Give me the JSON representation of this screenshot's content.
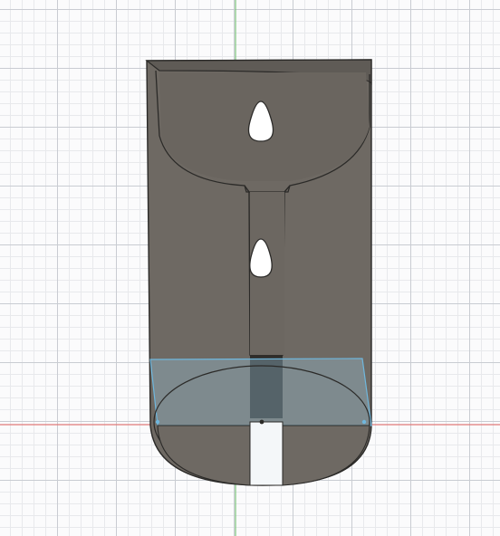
{
  "scene": {
    "background_color": "#fbfbfc",
    "grid_minor_color": "#e8e9ec",
    "grid_major_color": "#c9ccd2",
    "axis_x_color": "#e07a7a",
    "axis_y_color": "#7ac27a",
    "model_fill_color": "#6e6963",
    "model_dark_color": "#55514c",
    "model_edge_color": "#2b2a28",
    "highlight_color": "#9ec9e0",
    "selection_color": "#6fb7dd"
  },
  "model": {
    "name": "",
    "keyhole_slots": 2
  }
}
